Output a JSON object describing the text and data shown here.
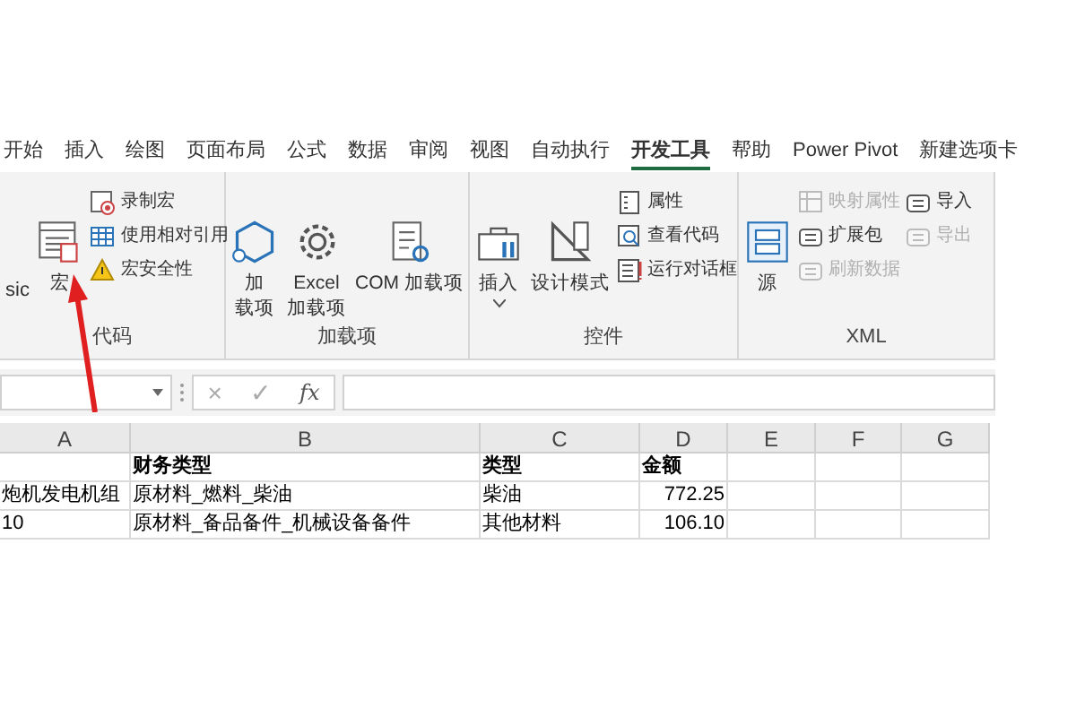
{
  "tabs": [
    {
      "label": "开始",
      "selected": false
    },
    {
      "label": "插入",
      "selected": false
    },
    {
      "label": "绘图",
      "selected": false
    },
    {
      "label": "页面布局",
      "selected": false
    },
    {
      "label": "公式",
      "selected": false
    },
    {
      "label": "数据",
      "selected": false
    },
    {
      "label": "审阅",
      "selected": false
    },
    {
      "label": "视图",
      "selected": false
    },
    {
      "label": "自动执行",
      "selected": false
    },
    {
      "label": "开发工具",
      "selected": true
    },
    {
      "label": "帮助",
      "selected": false
    },
    {
      "label": "Power Pivot",
      "selected": false
    },
    {
      "label": "新建选项卡",
      "selected": false
    }
  ],
  "ribbon_groups": [
    {
      "label": "代码",
      "items": [
        {
          "kind": "cut",
          "lines": [
            "sic"
          ]
        },
        {
          "kind": "large",
          "lines": [
            "宏"
          ]
        },
        {
          "kind": "stack",
          "buttons": [
            {
              "label": "录制宏",
              "disabled": false
            },
            {
              "label": "使用相对引用",
              "disabled": false
            },
            {
              "label": "宏安全性",
              "disabled": false
            }
          ]
        }
      ]
    },
    {
      "label": "加载项",
      "items": [
        {
          "kind": "large",
          "lines": [
            "加",
            "载项"
          ]
        },
        {
          "kind": "large",
          "lines": [
            "Excel",
            "加载项"
          ]
        },
        {
          "kind": "large",
          "lines": [
            "COM 加载项"
          ]
        }
      ]
    },
    {
      "label": "控件",
      "items": [
        {
          "kind": "menu",
          "lines": [
            "插入"
          ]
        },
        {
          "kind": "large",
          "lines": [
            "设计模式"
          ]
        },
        {
          "kind": "stack",
          "buttons": [
            {
              "label": "属性",
              "disabled": false
            },
            {
              "label": "查看代码",
              "disabled": false
            },
            {
              "label": "运行对话框",
              "disabled": false
            }
          ]
        }
      ]
    },
    {
      "label": "XML",
      "items": [
        {
          "kind": "large",
          "lines": [
            "源"
          ]
        },
        {
          "kind": "stack",
          "buttons": [
            {
              "label": "映射属性",
              "disabled": true
            },
            {
              "label": "扩展包",
              "disabled": false
            },
            {
              "label": "刷新数据",
              "disabled": true
            }
          ]
        },
        {
          "kind": "stack",
          "buttons": [
            {
              "label": "导入",
              "disabled": false
            },
            {
              "label": "导出",
              "disabled": true
            }
          ]
        }
      ]
    }
  ],
  "formula_bar": {
    "cancel": "×",
    "enter": "✓",
    "function": "fx"
  },
  "columns": [
    "A",
    "B",
    "C",
    "D",
    "E",
    "F",
    "G"
  ],
  "rows": [
    {
      "b": "财务类型",
      "c": "类型",
      "d": "金额"
    },
    {
      "a": "炮机发电机组",
      "b": "原材料_燃料_柴油",
      "c": "柴油",
      "d": "772.25"
    },
    {
      "a": "10",
      "b": "原材料_备品备件_机械设备备件",
      "c": "其他材料",
      "d": "106.10"
    }
  ]
}
